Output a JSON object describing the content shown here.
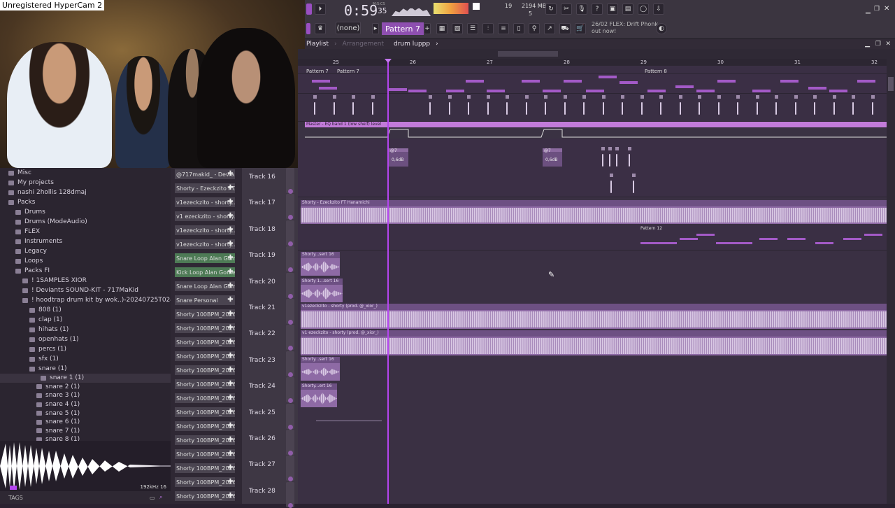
{
  "recorder_label": "Unregistered HyperCam 2",
  "toolbar": {
    "time_main": "0:59",
    "time_sub": "35",
    "time_unit": "M:S:CS",
    "cpu": "19",
    "memory": "2194 MB",
    "voices": "5",
    "pattern_mode": "(none)",
    "pattern": "Pattern 7",
    "news_line1": "26/02  FLEX: Drift Phonk",
    "news_line2": "out now!"
  },
  "playlist_bar": {
    "title": "Playlist",
    "sep": "›",
    "section": "Arrangement",
    "pattern": "drum luppp",
    "arrow": "›"
  },
  "ruler": {
    "bars": [
      "25",
      "26",
      "27",
      "28",
      "29",
      "30",
      "31",
      "32"
    ]
  },
  "pattern_labels": {
    "a": "Pattern 7",
    "b": "Pattern 7",
    "c": "Pattern 8",
    "d": "Pattern 12"
  },
  "automation": {
    "label": "Master - EQ band 1 (low shelf) level",
    "clip1": "@7",
    "clip1_val": "0,6dB",
    "clip2": "@7",
    "clip2_val": "0,6dB"
  },
  "audio_clips": {
    "t17": "Shorty - Ezeckzito FT Hanamichi",
    "t19": "Shorty...sert 16",
    "t20": "Shorty 1...sert 16",
    "t21": "v1ezeckzito - shorty (prod. @_xior_)",
    "t22": "v1 ezeckzito - shorty (prod. @_xior_)",
    "t23": "Shorty...sert 16",
    "t24": "Shorty...ert 16"
  },
  "tracks": [
    "Track 16",
    "Track 17",
    "Track 18",
    "Track 19",
    "Track 20",
    "Track 21",
    "Track 22",
    "Track 23",
    "Track 24",
    "Track 25",
    "Track 26",
    "Track 27",
    "Track 28"
  ],
  "browser": {
    "items": [
      {
        "label": "Misc",
        "indent": 12
      },
      {
        "label": "My projects",
        "indent": 12
      },
      {
        "label": "nashi 2hollis 128dmaj",
        "indent": 12
      },
      {
        "label": "Packs",
        "indent": 12
      },
      {
        "label": "Drums",
        "indent": 22
      },
      {
        "label": "Drums (ModeAudio)",
        "indent": 22
      },
      {
        "label": "FLEX",
        "indent": 22
      },
      {
        "label": "Instruments",
        "indent": 22
      },
      {
        "label": "Legacy",
        "indent": 22
      },
      {
        "label": "Loops",
        "indent": 22
      },
      {
        "label": "Packs FI",
        "indent": 22
      },
      {
        "label": "! 1SAMPLES XIOR",
        "indent": 32
      },
      {
        "label": "! Deviants SOUND-KIT - 717MaKid",
        "indent": 32
      },
      {
        "label": "! hoodtrap drum kit by wok..)-20240725T024728Z-001",
        "indent": 32
      },
      {
        "label": "808 (1)",
        "indent": 42
      },
      {
        "label": "clap (1)",
        "indent": 42
      },
      {
        "label": "hihats (1)",
        "indent": 42
      },
      {
        "label": "openhats (1)",
        "indent": 42
      },
      {
        "label": "percs (1)",
        "indent": 42
      },
      {
        "label": "sfx (1)",
        "indent": 42
      },
      {
        "label": "snare (1)",
        "indent": 42
      },
      {
        "label": "snare 1 (1)",
        "indent": 58
      },
      {
        "label": "snare 2 (1)",
        "indent": 52
      },
      {
        "label": "snare 3 (1)",
        "indent": 52
      },
      {
        "label": "snare 4 (1)",
        "indent": 52
      },
      {
        "label": "snare 5 (1)",
        "indent": 52
      },
      {
        "label": "snare 6 (1)",
        "indent": 52
      },
      {
        "label": "snare 7 (1)",
        "indent": 52
      },
      {
        "label": "snare 8 (1)",
        "indent": 52
      }
    ]
  },
  "preview": {
    "info": "192kHz 16",
    "tags": "TAGS"
  },
  "channels": [
    {
      "label": "@717makid_ - Devia..",
      "green": false
    },
    {
      "label": "Shorty - Ezeckzito FT..",
      "green": false
    },
    {
      "label": "v1ezeckzito - shorty..",
      "green": false
    },
    {
      "label": "v1 ezeckzito - shorty..",
      "green": false
    },
    {
      "label": "v1ezeckzito - shorty..",
      "green": false
    },
    {
      "label": "v1ezeckzito - shorty..",
      "green": false
    },
    {
      "label": "Snare Loop Alan Gome..",
      "green": true
    },
    {
      "label": "Kick Loop Alan Gome..",
      "green": true
    },
    {
      "label": "Snare Loop Alan Gom..",
      "green": false
    },
    {
      "label": "Snare Personal",
      "green": false
    },
    {
      "label": "Shorty 100BPM_2026-03..",
      "green": false
    },
    {
      "label": "Shorty 100BPM_2026-03..",
      "green": false
    },
    {
      "label": "Shorty 100BPM_2026-03..",
      "green": false
    },
    {
      "label": "Shorty 100BPM_2026-03..",
      "green": false
    },
    {
      "label": "Shorty 100BPM_2026-03..",
      "green": false
    },
    {
      "label": "Shorty 100BPM_2026-03..",
      "green": false
    },
    {
      "label": "Shorty 100BPM_2026-03..",
      "green": false
    },
    {
      "label": "Shorty 100BPM_2026-03..",
      "green": false
    },
    {
      "label": "Shorty 100BPM_2026-03..",
      "green": false
    },
    {
      "label": "Shorty 100BPM_2026-03..",
      "green": false
    },
    {
      "label": "Shorty 100BPM_2026-03..",
      "green": false
    },
    {
      "label": "Shorty 100BPM_2026-03..",
      "green": false
    },
    {
      "label": "Shorty 100BPM_2026-03..",
      "green": false
    },
    {
      "label": "Shorty 100BPM_2026-03..",
      "green": false
    }
  ]
}
